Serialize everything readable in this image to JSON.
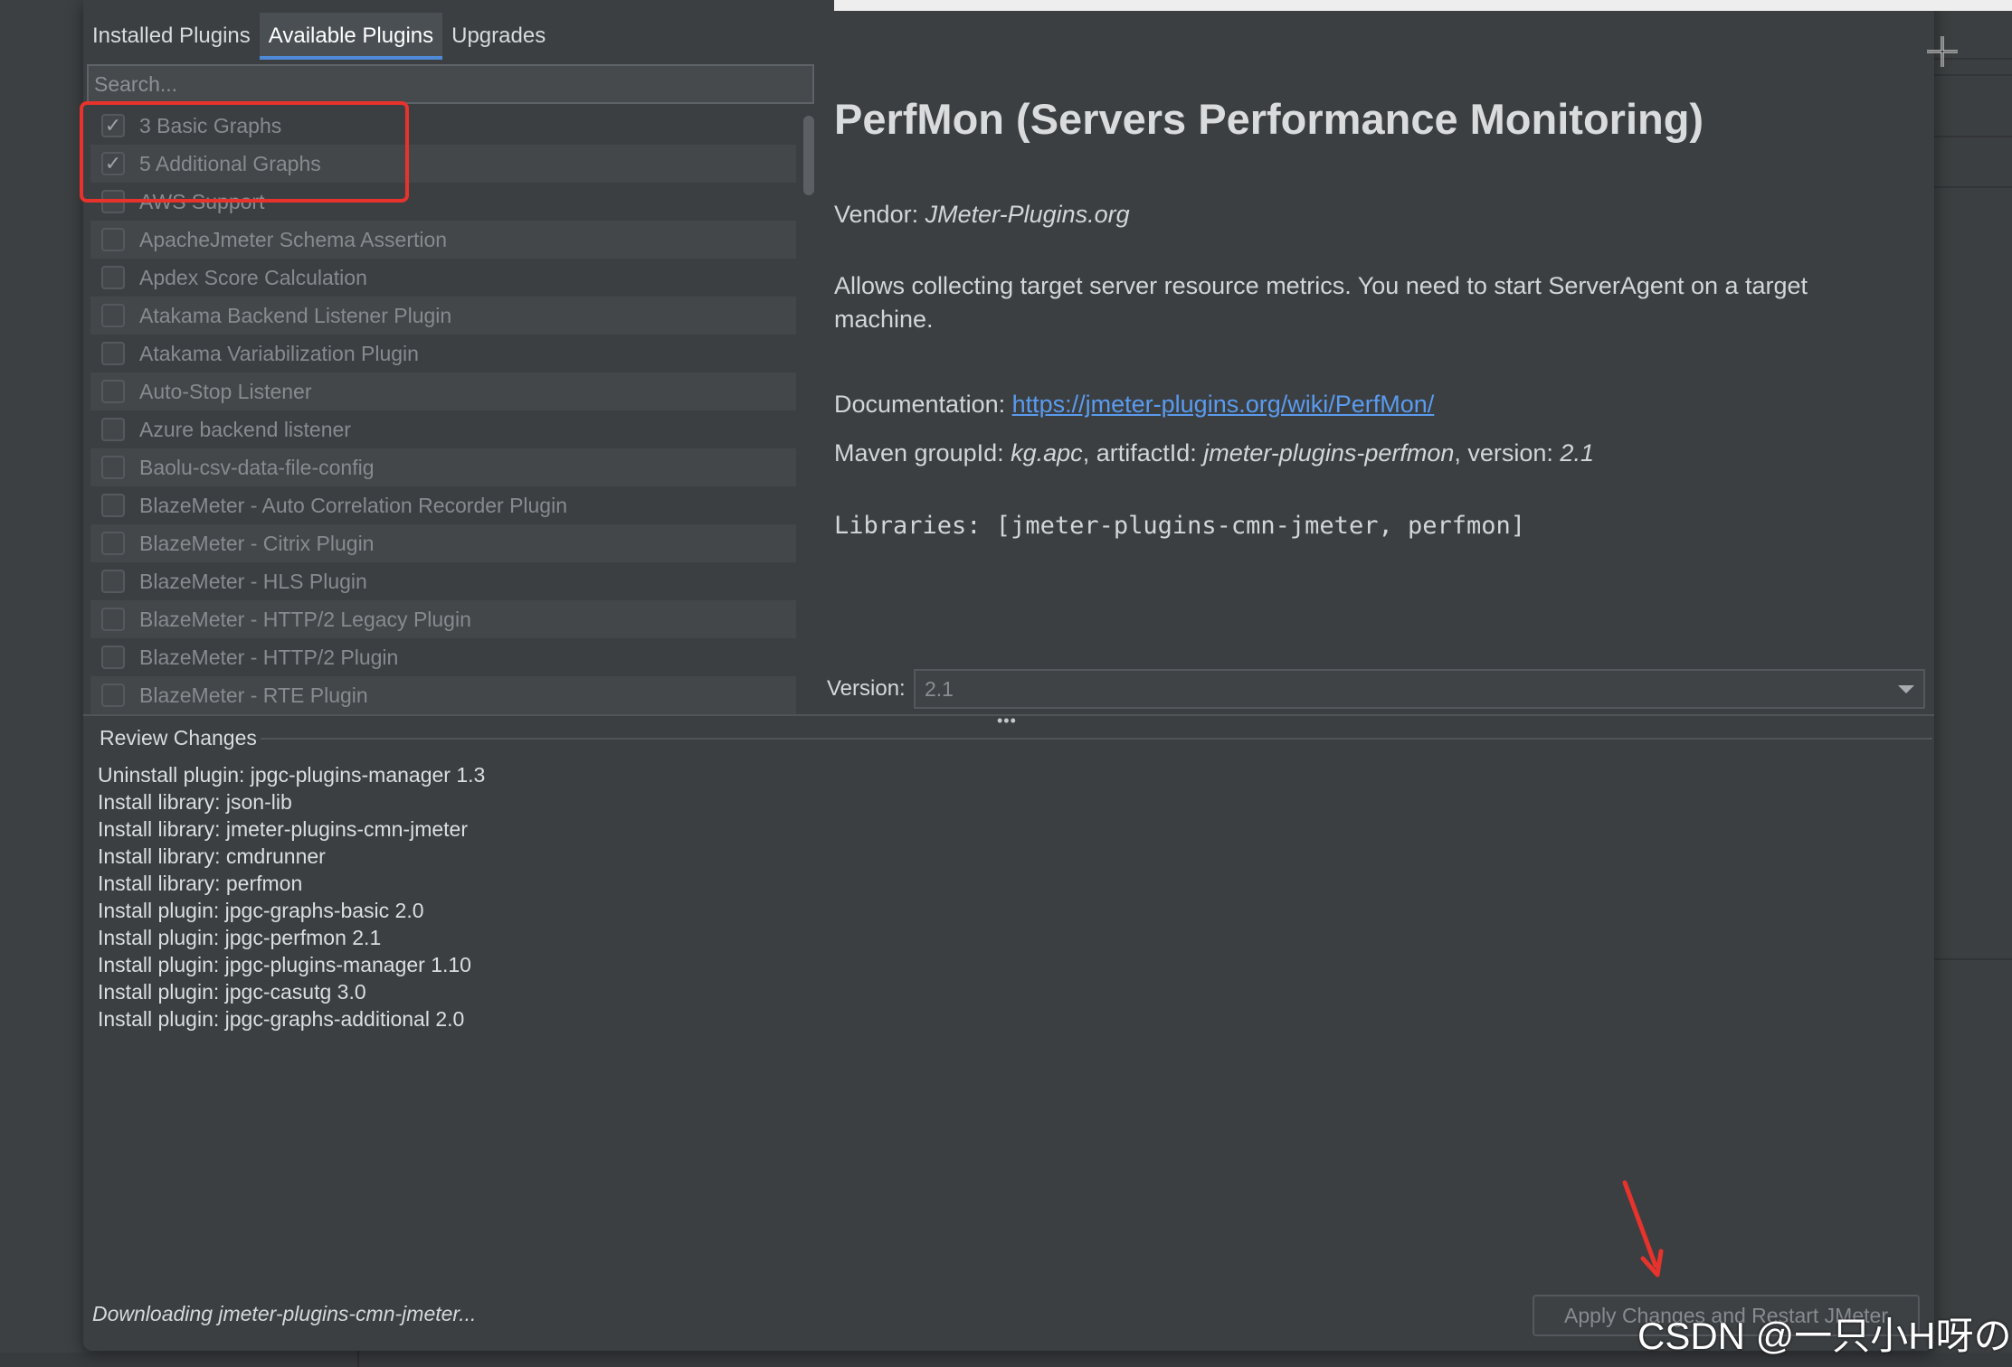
{
  "tabs": [
    {
      "label": "Installed Plugins"
    },
    {
      "label": "Available Plugins"
    },
    {
      "label": "Upgrades"
    }
  ],
  "search": {
    "placeholder": "Search..."
  },
  "plugins": [
    {
      "label": "3 Basic Graphs",
      "checked": true
    },
    {
      "label": "5 Additional Graphs",
      "checked": true
    },
    {
      "label": "AWS Support",
      "checked": false
    },
    {
      "label": "ApacheJmeter Schema Assertion",
      "checked": false
    },
    {
      "label": "Apdex Score Calculation",
      "checked": false
    },
    {
      "label": "Atakama Backend Listener Plugin",
      "checked": false
    },
    {
      "label": "Atakama Variabilization Plugin",
      "checked": false
    },
    {
      "label": "Auto-Stop Listener",
      "checked": false
    },
    {
      "label": "Azure backend listener",
      "checked": false
    },
    {
      "label": "Baolu-csv-data-file-config",
      "checked": false
    },
    {
      "label": "BlazeMeter - Auto Correlation Recorder Plugin",
      "checked": false
    },
    {
      "label": "BlazeMeter - Citrix Plugin",
      "checked": false
    },
    {
      "label": "BlazeMeter - HLS Plugin",
      "checked": false
    },
    {
      "label": "BlazeMeter - HTTP/2 Legacy Plugin",
      "checked": false
    },
    {
      "label": "BlazeMeter - HTTP/2 Plugin",
      "checked": false
    },
    {
      "label": "BlazeMeter - RTE Plugin",
      "checked": false
    }
  ],
  "detail": {
    "title": "PerfMon (Servers Performance Monitoring)",
    "vendor_label": "Vendor: ",
    "vendor": "JMeter-Plugins.org",
    "description": "Allows collecting target server resource metrics. You need to start ServerAgent on a target machine.",
    "doc_label": "Documentation: ",
    "doc_url": "https://jmeter-plugins.org/wiki/PerfMon/",
    "maven_label": "Maven groupId: ",
    "group_id": "kg.apc",
    "artifact_label": ", artifactId: ",
    "artifact_id": "jmeter-plugins-perfmon",
    "version_label_inline": ", version: ",
    "version": "2.1",
    "libraries": "Libraries: [jmeter-plugins-cmn-jmeter, perfmon]"
  },
  "version_select": {
    "label": "Version:",
    "value": "2.1"
  },
  "review": {
    "title": "Review Changes",
    "items": [
      "Uninstall plugin: jpgc-plugins-manager 1.3",
      "Install library: json-lib",
      "Install library: jmeter-plugins-cmn-jmeter",
      "Install library: cmdrunner",
      "Install library: perfmon",
      "Install plugin: jpgc-graphs-basic 2.0",
      "Install plugin: jpgc-perfmon 2.1",
      "Install plugin: jpgc-plugins-manager 1.10",
      "Install plugin: jpgc-casutg 3.0",
      "Install plugin: jpgc-graphs-additional 2.0"
    ]
  },
  "status": "Downloading jmeter-plugins-cmn-jmeter...",
  "apply_button": "Apply Changes and Restart JMeter",
  "watermark": "CSDN @一只小H呀の",
  "colors": {
    "highlight": "#e8322c",
    "tab_accent": "#4f8ad8",
    "link": "#5a9bef"
  }
}
